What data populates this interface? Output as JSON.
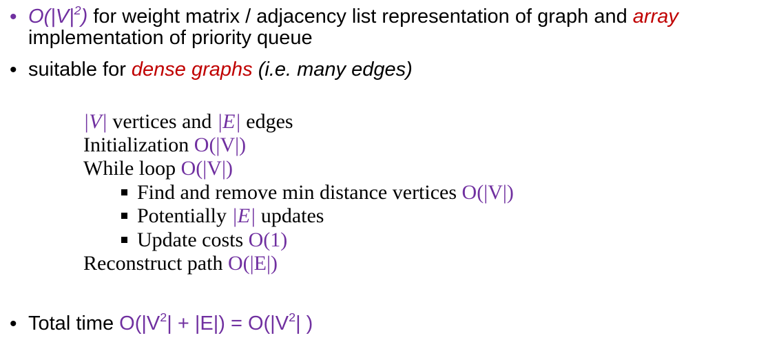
{
  "bullet1": {
    "prefix_math": "O(|V|",
    "prefix_sup": "2",
    "prefix_close": ")",
    "text": " for weight matrix / adjacency list representation of graph and ",
    "emph": "array",
    "line2": "implementation of priority queue"
  },
  "bullet2": {
    "text": "suitable for ",
    "emph": "dense graphs",
    "rest": " (i.e. many edges)"
  },
  "analysis": {
    "line1": {
      "a": "|V|",
      "b": " vertices and ",
      "c": "|E|",
      "d": " edges"
    },
    "line2": {
      "text": "Initialization ",
      "cost": "O(|V|)"
    },
    "line3": {
      "text": "While loop ",
      "cost": "O(|V|)"
    },
    "sub1": {
      "text": "Find and remove min distance vertices ",
      "cost": "O(|V|)"
    },
    "sub2": {
      "text": "Potentially ",
      "cost": "|E|",
      "rest": " updates"
    },
    "sub3": {
      "text": "Update costs ",
      "cost": "O(1)"
    },
    "line4": {
      "text": "Reconstruct path ",
      "cost": "O(|E|)"
    }
  },
  "bullet3": {
    "text": "Total time ",
    "formula_a": "O(|V",
    "formula_a_sup": "2",
    "formula_b": "| + |E|) = O(|V",
    "formula_b_sup": "2",
    "formula_c": "| )"
  },
  "colors": {
    "math": "#7030a0",
    "emphasis": "#c00000",
    "bullet_purple": "#7030a0"
  }
}
